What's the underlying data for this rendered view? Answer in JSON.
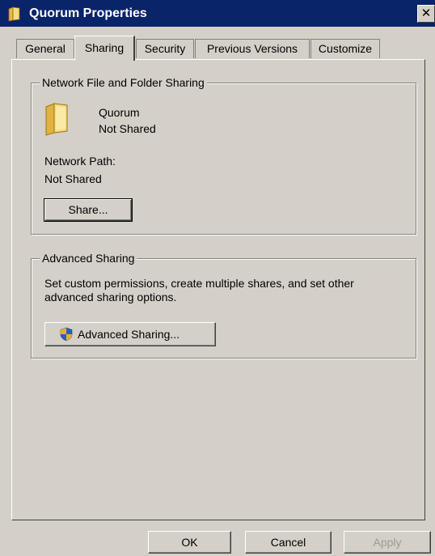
{
  "window": {
    "title": "Quorum Properties",
    "close_label": "✕"
  },
  "tabs": [
    {
      "label": "General",
      "active": false
    },
    {
      "label": "Sharing",
      "active": true
    },
    {
      "label": "Security",
      "active": false
    },
    {
      "label": "Previous Versions",
      "active": false
    },
    {
      "label": "Customize",
      "active": false
    }
  ],
  "network_sharing": {
    "legend": "Network File and Folder Sharing",
    "folder_name": "Quorum",
    "folder_status": "Not Shared",
    "network_path_label": "Network Path:",
    "network_path_value": "Not Shared",
    "share_button": "Share..."
  },
  "advanced_sharing": {
    "legend": "Advanced Sharing",
    "description_line1": "Set custom permissions, create multiple shares, and set other",
    "description_line2": "advanced sharing options.",
    "button": "Advanced Sharing..."
  },
  "footer": {
    "ok": "OK",
    "cancel": "Cancel",
    "apply": "Apply"
  },
  "colors": {
    "titlebar": "#0a246a",
    "dialog_face": "#d4d0c8",
    "folder": "#f2d36b"
  }
}
